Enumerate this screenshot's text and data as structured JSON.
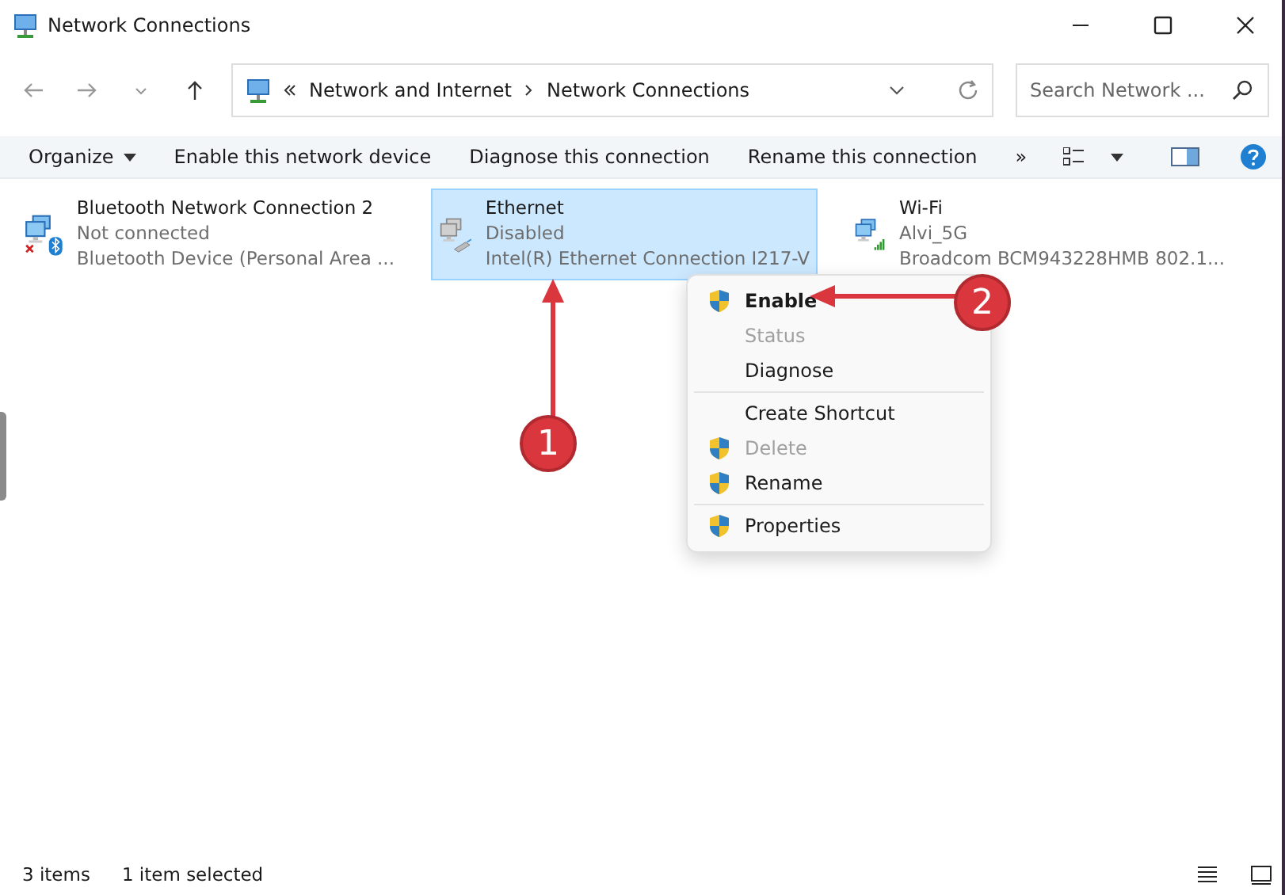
{
  "window": {
    "title": "Network Connections"
  },
  "address_bar": {
    "crumbs": [
      "Network and Internet",
      "Network Connections"
    ]
  },
  "search": {
    "placeholder": "Search Network ..."
  },
  "command_bar": {
    "items": [
      {
        "label": "Organize",
        "dropdown": true
      },
      {
        "label": "Enable this network device",
        "dropdown": false
      },
      {
        "label": "Diagnose this connection",
        "dropdown": false
      },
      {
        "label": "Rename this connection",
        "dropdown": false
      },
      {
        "label": "»",
        "dropdown": false
      }
    ]
  },
  "connections": [
    {
      "kind": "bluetooth",
      "name": "Bluetooth Network Connection 2",
      "status": "Not connected",
      "device": "Bluetooth Device (Personal Area ...",
      "selected": false
    },
    {
      "kind": "ethernet",
      "name": "Ethernet",
      "status": "Disabled",
      "device": "Intel(R) Ethernet Connection I217-V",
      "selected": true
    },
    {
      "kind": "wifi",
      "name": "Wi-Fi",
      "status": "Alvi_5G",
      "device": "Broadcom BCM943228HMB 802.1...",
      "selected": false
    }
  ],
  "context_menu": {
    "groups": [
      [
        {
          "label": "Enable",
          "shield": true,
          "default": true,
          "disabled": false
        },
        {
          "label": "Status",
          "shield": false,
          "default": false,
          "disabled": true
        },
        {
          "label": "Diagnose",
          "shield": false,
          "default": false,
          "disabled": false
        }
      ],
      [
        {
          "label": "Create Shortcut",
          "shield": false,
          "default": false,
          "disabled": false
        },
        {
          "label": "Delete",
          "shield": true,
          "default": false,
          "disabled": true
        },
        {
          "label": "Rename",
          "shield": true,
          "default": false,
          "disabled": false
        }
      ],
      [
        {
          "label": "Properties",
          "shield": true,
          "default": false,
          "disabled": false
        }
      ]
    ]
  },
  "callouts": [
    {
      "number": "1"
    },
    {
      "number": "2"
    }
  ],
  "status_bar": {
    "count": "3 items",
    "selection": "1 item selected"
  }
}
